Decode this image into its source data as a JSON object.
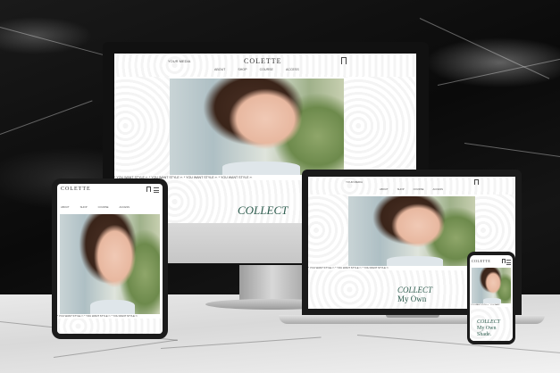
{
  "brand": {
    "logo": "COLETTE",
    "accent": "#2f5d4f"
  },
  "desktop": {
    "top_left": "YOUR MEDIA",
    "nav": [
      "ABOUT",
      "SHOP",
      "COURSE",
      "ACCESS"
    ],
    "icon": "bookmark-icon",
    "ticker": "* YOU WANT STYLE ✂ * YOU WANT STYLE ✂ * YOU WANT STYLE ✂ * YOU WANT STYLE ✂",
    "hero_title": "COLLECT"
  },
  "laptop": {
    "top_left": "YOUR MEDIA",
    "nav": [
      "ABOUT",
      "SHOP",
      "COURSE",
      "ACCESS"
    ],
    "ticker": "* YOU WANT STYLE ✂ * YOU WANT STYLE ✂ * YOU WANT STYLE ✂",
    "hero_title": "COLLECT",
    "hero_line2": "My Own"
  },
  "tablet": {
    "logo": "COLETTE",
    "nav": [
      "ABOUT",
      "SHOP",
      "COURSE",
      "ACCESS"
    ],
    "ticker": "* YOU WANT STYLE ✂ * YOU WANT STYLE ✂ * YOU WANT STYLE ✂"
  },
  "phone": {
    "logo": "COLETTE",
    "ticker": "* YOU WANT STYLE ✂ * YOU WANT",
    "hero_title": "COLLECT",
    "hero_line2": "My Own",
    "hero_line3": "Shade."
  }
}
